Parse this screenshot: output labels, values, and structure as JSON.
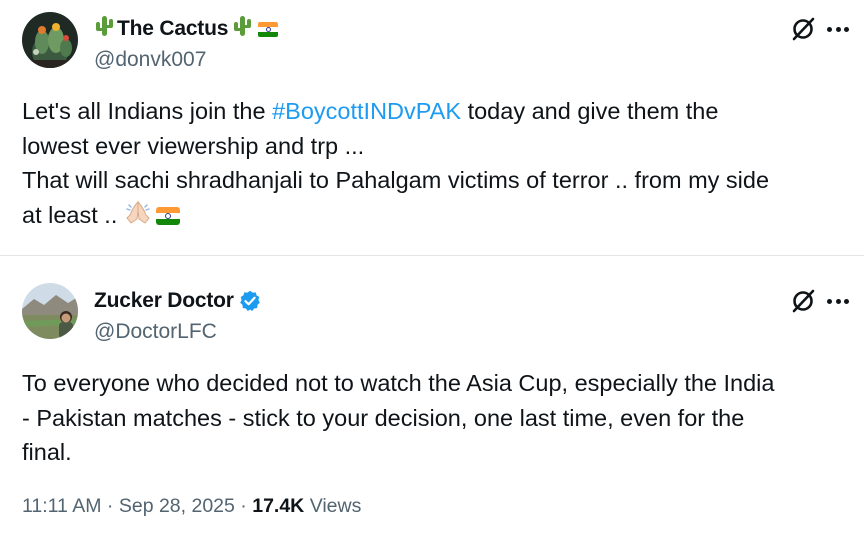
{
  "tweets": [
    {
      "display_name": "The Cactus",
      "handle": "@donvk007",
      "avatar_icon": "cactus-avatar-icon",
      "name_emojis": [
        "cactus-icon",
        "cactus-icon",
        "india-flag-icon"
      ],
      "text": {
        "line1_before": "Let's all Indians join the ",
        "hashtag": "#BoycottINDvPAK",
        "line1_after": " today and give them the",
        "line2": "lowest ever viewership and trp ...",
        "line3": "That will sachi shradhanjali to Pahalgam victims of terror .. from my side",
        "line4": "at least .. "
      },
      "trailing_emojis": [
        "folded-hands-icon",
        "india-flag-icon"
      ]
    },
    {
      "display_name": "Zucker Doctor",
      "handle": "@DoctorLFC",
      "avatar_icon": "landscape-avatar-icon",
      "verified": true,
      "text": {
        "line1": "To everyone who decided not to watch the Asia Cup, especially the India",
        "line2": "- Pakistan matches - stick to your decision, one last time, even for the",
        "line3": "final."
      },
      "time": "11:11 AM",
      "separator": "·",
      "date": "Sep 28, 2025",
      "views_count": "17.4K",
      "views_label": "Views"
    }
  ],
  "colors": {
    "text": "#0f1419",
    "secondary": "#536471",
    "link": "#1d9bf0",
    "verified": "#1d9bf0",
    "divider": "#e6e6e6"
  }
}
